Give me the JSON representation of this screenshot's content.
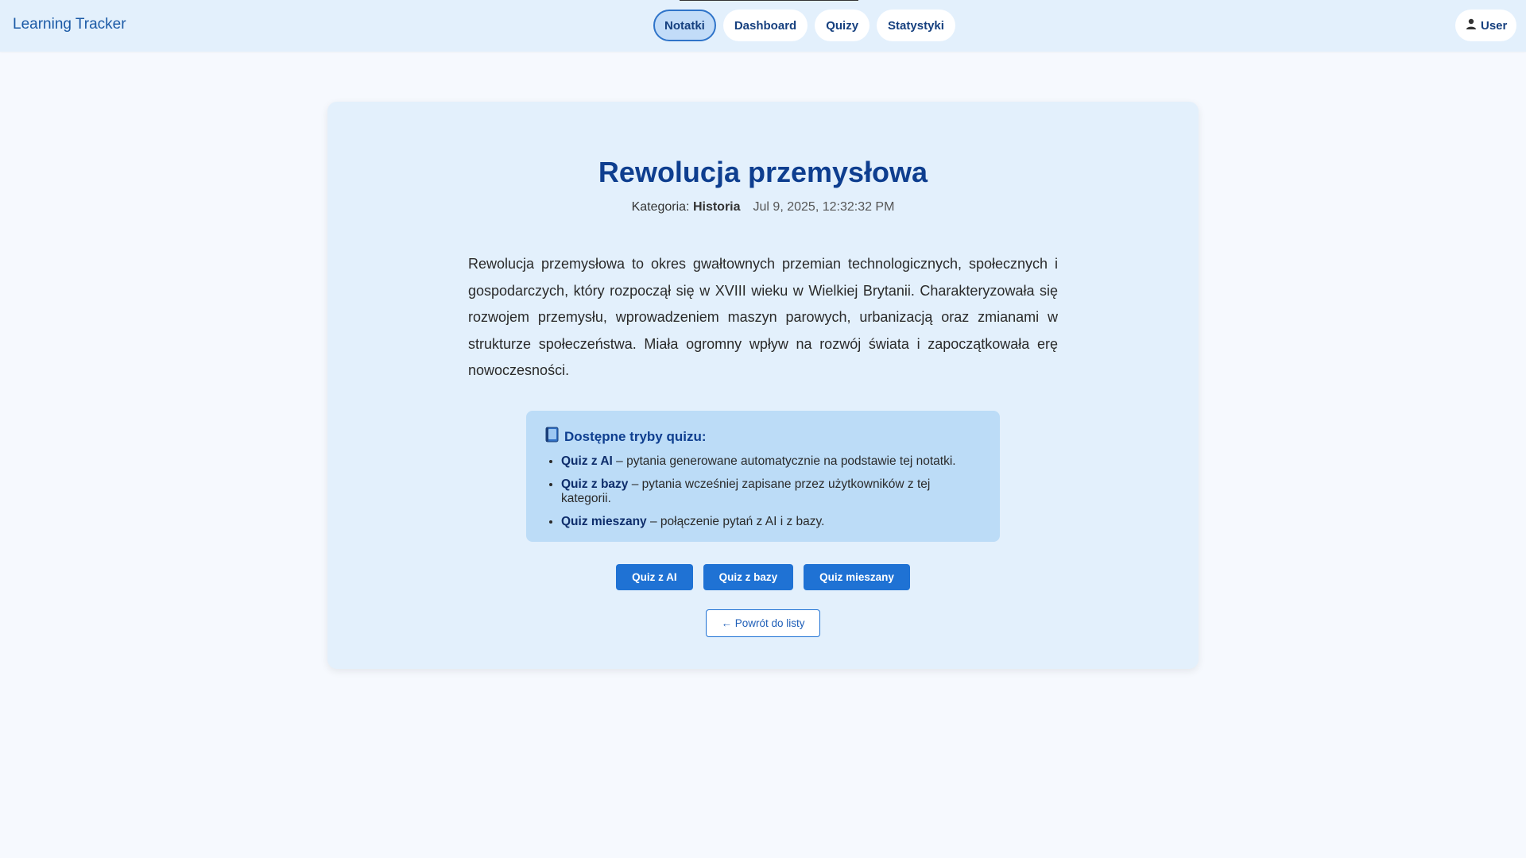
{
  "app": {
    "brand": "Learning Tracker"
  },
  "nav": {
    "tabs": [
      {
        "label": "Notatki",
        "active": true
      },
      {
        "label": "Dashboard",
        "active": false
      },
      {
        "label": "Quizy",
        "active": false
      },
      {
        "label": "Statystyki",
        "active": false
      }
    ],
    "user_label": "User",
    "user_icon": "user-icon"
  },
  "note": {
    "title": "Rewolucja przemysłowa",
    "category_label": "Kategoria:",
    "category": "Historia",
    "timestamp": "Jul 9, 2025, 12:32:32 PM",
    "content": "Rewolucja przemysłowa to okres gwałtownych przemian technologicznych, społecznych i gospodarczych, który rozpoczął się w XVIII wieku w Wielkiej Brytanii. Charakteryzowała się rozwojem przemysłu, wprowadzeniem maszyn parowych, urbanizacją oraz zmianami w strukturze społeczeństwa. Miała ogromny wpływ na rozwój świata i zapoczątkowała erę nowoczesności."
  },
  "info": {
    "icon": "book-icon",
    "title": "Dostępne tryby quizu:",
    "items": [
      {
        "name": "Quiz z AI",
        "desc": " – pytania generowane automatycznie na podstawie tej notatki."
      },
      {
        "name": "Quiz z bazy",
        "desc": " – pytania wcześniej zapisane przez użytkowników z tej kategorii."
      },
      {
        "name": "Quiz mieszany",
        "desc": " – połączenie pytań z AI i z bazy."
      }
    ]
  },
  "actions": {
    "quiz_ai": "Quiz z AI",
    "quiz_db": "Quiz z bazy",
    "quiz_mixed": "Quiz mieszany",
    "back": "← Powrót do listy"
  },
  "colors": {
    "primary": "#1f72d4",
    "title": "#0e3e8f",
    "card_bg": "#e3f0fc",
    "info_bg": "#bcdcf7"
  }
}
